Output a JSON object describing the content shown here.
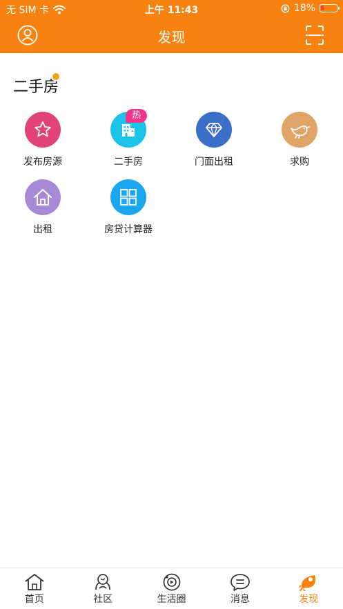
{
  "status": {
    "carrier": "无 SIM 卡",
    "time": "上午 11:43",
    "battery": "18%"
  },
  "nav": {
    "title": "发现"
  },
  "section": {
    "title": "二手房"
  },
  "grid": {
    "items": [
      {
        "label": "发布房源",
        "color": "#e04478",
        "icon": "star-icon"
      },
      {
        "label": "二手房",
        "color": "#1cc3e8",
        "icon": "building-icon",
        "badge": "热"
      },
      {
        "label": "门面出租",
        "color": "#3a6ec9",
        "icon": "diamond-icon"
      },
      {
        "label": "求购",
        "color": "#e0a466",
        "icon": "bird-icon"
      },
      {
        "label": "出租",
        "color": "#a68ad6",
        "icon": "home-icon"
      },
      {
        "label": "房贷计算器",
        "color": "#1ba7ee",
        "icon": "grid-icon"
      }
    ]
  },
  "tabs": [
    {
      "label": "首页",
      "icon": "house-icon"
    },
    {
      "label": "社区",
      "icon": "community-icon"
    },
    {
      "label": "生活圈",
      "icon": "life-circle-icon"
    },
    {
      "label": "消息",
      "icon": "message-icon"
    },
    {
      "label": "发现",
      "icon": "discover-icon",
      "active": true
    }
  ],
  "colors": {
    "brand": "#f7820f",
    "badge": "#f0348c"
  }
}
